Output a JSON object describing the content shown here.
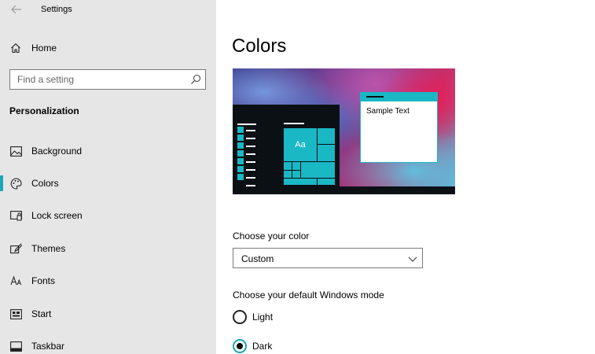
{
  "window": {
    "title": "Settings"
  },
  "sidebar": {
    "home_label": "Home",
    "search_placeholder": "Find a setting",
    "section_heading": "Personalization",
    "items": [
      {
        "label": "Background",
        "icon": "picture-icon"
      },
      {
        "label": "Colors",
        "icon": "palette-icon",
        "selected": true
      },
      {
        "label": "Lock screen",
        "icon": "lock-screen-icon"
      },
      {
        "label": "Themes",
        "icon": "brush-icon"
      },
      {
        "label": "Fonts",
        "icon": "font-icon"
      },
      {
        "label": "Start",
        "icon": "start-icon"
      },
      {
        "label": "Taskbar",
        "icon": "taskbar-icon"
      }
    ]
  },
  "main": {
    "page_title": "Colors",
    "preview": {
      "tile_text": "Aa",
      "sample_text": "Sample Text"
    },
    "choose_color_label": "Choose your color",
    "choose_color_value": "Custom",
    "windows_mode_label": "Choose your default Windows mode",
    "mode_options": [
      {
        "label": "Light",
        "checked": false
      },
      {
        "label": "Dark",
        "checked": true
      }
    ]
  },
  "colors": {
    "accent": "#1ab7c4",
    "sidebar_bg": "#e6e6e6",
    "preview_dark": "#0b1015"
  }
}
